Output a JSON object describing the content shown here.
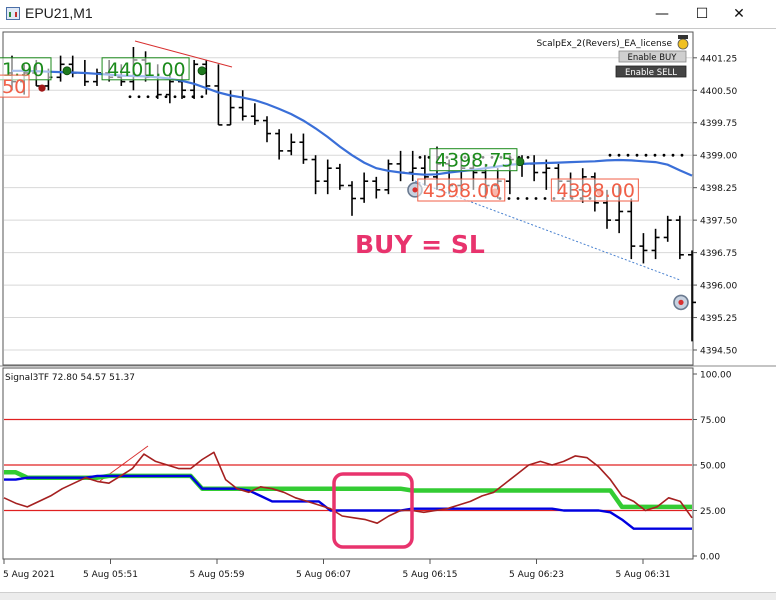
{
  "window": {
    "title": "EPU21,M1",
    "minimize_glyph": "—",
    "maximize_glyph": "☐",
    "close_glyph": "✕"
  },
  "ea_panel": {
    "name": "ScalpEx_2(Revers)_EA_license",
    "enable_buy": "Enable BUY",
    "enable_sell": "Enable SELL",
    "icon": "smiley-hat-icon"
  },
  "annotation": {
    "text": "BUY = SL",
    "color": "#e8336d"
  },
  "indicator": {
    "label": "Signal3TF 72.80 54.57 51.37"
  },
  "colors": {
    "blue_ma": "#3a6fd8",
    "dark_red": "#a52020",
    "green": "#33cc33",
    "blue_signal": "#0000e0",
    "level_line": "#e02020",
    "buy_label": "#1a8a1a",
    "sell_label": "#f06048",
    "highlight_box": "#e8336d"
  },
  "chart_data": [
    {
      "type": "candlestick-bar",
      "title": "",
      "y_ticks": [
        "4401.25",
        "4400.50",
        "4399.75",
        "4399.00",
        "4398.25",
        "4397.50",
        "4396.75",
        "4396.00",
        "4395.25",
        "4394.50"
      ],
      "ylim": [
        4394.2,
        4401.8
      ],
      "bars": [
        {
          "o": 4400.9,
          "h": 4401.3,
          "l": 4400.5,
          "c": 4400.7
        },
        {
          "o": 4400.7,
          "h": 4401.1,
          "l": 4400.4,
          "c": 4400.9
        },
        {
          "o": 4400.9,
          "h": 4401.2,
          "l": 4400.6,
          "c": 4400.6
        },
        {
          "o": 4400.6,
          "h": 4401.0,
          "l": 4400.5,
          "c": 4400.8
        },
        {
          "o": 4400.8,
          "h": 4401.3,
          "l": 4400.7,
          "c": 4401.1
        },
        {
          "o": 4401.1,
          "h": 4401.3,
          "l": 4400.8,
          "c": 4400.9
        },
        {
          "o": 4400.9,
          "h": 4401.2,
          "l": 4400.6,
          "c": 4400.7
        },
        {
          "o": 4400.7,
          "h": 4401.0,
          "l": 4400.6,
          "c": 4400.9
        },
        {
          "o": 4400.9,
          "h": 4401.2,
          "l": 4400.7,
          "c": 4400.8
        },
        {
          "o": 4400.8,
          "h": 4401.1,
          "l": 4400.6,
          "c": 4400.7
        },
        {
          "o": 4400.7,
          "h": 4401.5,
          "l": 4400.5,
          "c": 4401.2
        },
        {
          "o": 4401.2,
          "h": 4401.4,
          "l": 4400.7,
          "c": 4400.8
        },
        {
          "o": 4400.8,
          "h": 4401.1,
          "l": 4400.3,
          "c": 4400.4
        },
        {
          "o": 4400.4,
          "h": 4400.9,
          "l": 4400.2,
          "c": 4400.7
        },
        {
          "o": 4400.7,
          "h": 4400.9,
          "l": 4400.3,
          "c": 4400.5
        },
        {
          "o": 4400.5,
          "h": 4401.2,
          "l": 4400.3,
          "c": 4401.1
        },
        {
          "o": 4401.1,
          "h": 4401.2,
          "l": 4400.4,
          "c": 4400.6
        },
        {
          "o": 4400.6,
          "h": 4401.1,
          "l": 4399.7,
          "c": 4399.7
        },
        {
          "o": 4399.7,
          "h": 4400.5,
          "l": 4399.7,
          "c": 4400.1
        },
        {
          "o": 4400.1,
          "h": 4400.5,
          "l": 4399.8,
          "c": 4399.9
        },
        {
          "o": 4399.9,
          "h": 4400.2,
          "l": 4399.7,
          "c": 4399.8
        },
        {
          "o": 4399.8,
          "h": 4399.9,
          "l": 4399.3,
          "c": 4399.5
        },
        {
          "o": 4399.5,
          "h": 4399.6,
          "l": 4398.9,
          "c": 4399.1
        },
        {
          "o": 4399.1,
          "h": 4399.5,
          "l": 4399.0,
          "c": 4399.3
        },
        {
          "o": 4399.3,
          "h": 4399.5,
          "l": 4398.8,
          "c": 4398.9
        },
        {
          "o": 4398.9,
          "h": 4399.0,
          "l": 4398.1,
          "c": 4398.4
        },
        {
          "o": 4398.4,
          "h": 4398.9,
          "l": 4398.1,
          "c": 4398.7
        },
        {
          "o": 4398.7,
          "h": 4398.8,
          "l": 4398.2,
          "c": 4398.3
        },
        {
          "o": 4398.3,
          "h": 4398.4,
          "l": 4397.6,
          "c": 4398.0
        },
        {
          "o": 4398.0,
          "h": 4398.6,
          "l": 4397.9,
          "c": 4398.4
        },
        {
          "o": 4398.4,
          "h": 4398.5,
          "l": 4398.0,
          "c": 4398.2
        },
        {
          "o": 4398.2,
          "h": 4398.9,
          "l": 4398.1,
          "c": 4398.8
        },
        {
          "o": 4398.8,
          "h": 4399.1,
          "l": 4398.4,
          "c": 4398.6
        },
        {
          "o": 4398.6,
          "h": 4399.1,
          "l": 4398.4,
          "c": 4398.7
        },
        {
          "o": 4398.7,
          "h": 4399.0,
          "l": 4398.3,
          "c": 4398.5
        },
        {
          "o": 4398.5,
          "h": 4399.2,
          "l": 4398.2,
          "c": 4398.8
        },
        {
          "o": 4398.8,
          "h": 4398.9,
          "l": 4398.1,
          "c": 4398.3
        },
        {
          "o": 4398.3,
          "h": 4398.9,
          "l": 4398.1,
          "c": 4398.7
        },
        {
          "o": 4398.7,
          "h": 4398.9,
          "l": 4398.2,
          "c": 4398.6
        },
        {
          "o": 4398.6,
          "h": 4398.8,
          "l": 4398.0,
          "c": 4398.3
        },
        {
          "o": 4398.3,
          "h": 4398.7,
          "l": 4398.0,
          "c": 4398.4
        },
        {
          "o": 4398.4,
          "h": 4399.0,
          "l": 4398.1,
          "c": 4398.9
        },
        {
          "o": 4398.9,
          "h": 4399.0,
          "l": 4398.5,
          "c": 4398.8
        },
        {
          "o": 4398.8,
          "h": 4399.0,
          "l": 4398.4,
          "c": 4398.6
        },
        {
          "o": 4398.6,
          "h": 4398.9,
          "l": 4398.2,
          "c": 4398.7
        },
        {
          "o": 4398.7,
          "h": 4398.8,
          "l": 4398.1,
          "c": 4398.4
        },
        {
          "o": 4398.4,
          "h": 4398.6,
          "l": 4398.0,
          "c": 4398.2
        },
        {
          "o": 4398.2,
          "h": 4398.7,
          "l": 4397.9,
          "c": 4398.5
        },
        {
          "o": 4398.5,
          "h": 4398.6,
          "l": 4397.7,
          "c": 4397.9
        },
        {
          "o": 4397.9,
          "h": 4398.2,
          "l": 4397.3,
          "c": 4397.5
        },
        {
          "o": 4397.5,
          "h": 4398.3,
          "l": 4397.2,
          "c": 4397.7
        },
        {
          "o": 4397.7,
          "h": 4398.0,
          "l": 4396.6,
          "c": 4396.9
        },
        {
          "o": 4396.9,
          "h": 4397.2,
          "l": 4396.5,
          "c": 4396.8
        },
        {
          "o": 4396.8,
          "h": 4397.3,
          "l": 4396.6,
          "c": 4397.1
        },
        {
          "o": 4397.1,
          "h": 4397.6,
          "l": 4397.0,
          "c": 4397.5
        },
        {
          "o": 4397.5,
          "h": 4397.6,
          "l": 4396.6,
          "c": 4396.7
        },
        {
          "o": 4396.7,
          "h": 4396.8,
          "l": 4394.7,
          "c": 4395.6
        }
      ],
      "ma_values": [
        4400.95,
        4400.95,
        4400.94,
        4400.93,
        4400.92,
        4400.91,
        4400.9,
        4400.88,
        4400.86,
        4400.84,
        4400.83,
        4400.82,
        4400.8,
        4400.77,
        4400.72,
        4400.65,
        4400.55,
        4400.45,
        4400.38,
        4400.33,
        4400.27,
        4400.18,
        4400.07,
        4399.95,
        4399.8,
        4399.62,
        4399.42,
        4399.2,
        4399.0,
        4398.83,
        4398.7,
        4398.64,
        4398.6,
        4398.57,
        4398.55,
        4398.56,
        4398.6,
        4398.63,
        4398.66,
        4398.7,
        4398.74,
        4398.78,
        4398.8,
        4398.81,
        4398.82,
        4398.83,
        4398.84,
        4398.85,
        4398.86,
        4398.88,
        4398.89,
        4398.88,
        4398.86,
        4398.84,
        4398.78,
        4398.65,
        4398.53
      ],
      "labels": [
        {
          "text": "1.90",
          "price": 4400.95,
          "bar": 0,
          "color": "#1a8a1a"
        },
        {
          "text": "4401.00",
          "price": 4400.95,
          "bar": 11,
          "color": "#1a8a1a"
        },
        {
          "text": "4398.75",
          "price": 4398.85,
          "bar": 38,
          "color": "#1a8a1a"
        },
        {
          "text": "50",
          "price": 4400.55,
          "bar": 0,
          "color": "#f06048"
        },
        {
          "text": "4398.00",
          "price": 4398.15,
          "bar": 37,
          "color": "#f06048"
        },
        {
          "text": "4398.00",
          "price": 4398.15,
          "bar": 48,
          "color": "#f06048"
        }
      ]
    },
    {
      "type": "line",
      "title": "",
      "y_ticks": [
        "100.00",
        "75.00",
        "50.00",
        "25.00",
        "0.00"
      ],
      "ylim": [
        0,
        100
      ],
      "levels": [
        75,
        50,
        25
      ],
      "x_ticks": [
        "5 Aug 2021",
        "5 Aug 05:51",
        "5 Aug 05:59",
        "5 Aug 06:07",
        "5 Aug 06:15",
        "5 Aug 06:23",
        "5 Aug 06:31"
      ],
      "series": [
        {
          "color": "#a52020",
          "values": [
            32,
            29,
            27,
            30,
            33,
            37,
            40,
            43,
            41,
            40,
            44,
            48,
            56,
            52,
            50,
            48,
            48,
            53,
            57,
            42,
            37,
            35,
            38,
            37,
            35,
            32,
            30,
            28,
            26,
            22,
            21,
            20,
            18,
            22,
            25,
            25,
            24,
            25,
            26,
            28,
            30,
            33,
            35,
            40,
            45,
            50,
            52,
            50,
            52,
            55,
            54,
            49,
            42,
            33,
            30,
            25,
            27,
            32,
            30,
            21
          ]
        },
        {
          "color": "#33cc33",
          "values": [
            46,
            46,
            43,
            43,
            43,
            43,
            43,
            43,
            43,
            44,
            44,
            44,
            44,
            44,
            44,
            44,
            44,
            37,
            37,
            37,
            37,
            37,
            37,
            37,
            37,
            37,
            37,
            37,
            37,
            37,
            37,
            37,
            37,
            37,
            37,
            36,
            36,
            36,
            36,
            36,
            36,
            36,
            36,
            36,
            36,
            36,
            36,
            36,
            36,
            36,
            36,
            36,
            36,
            27,
            27,
            27,
            27,
            27,
            27,
            27
          ]
        },
        {
          "color": "#0000e0",
          "values": [
            42,
            42,
            43,
            43,
            43,
            43,
            43,
            43,
            44,
            44,
            44,
            44,
            44,
            44,
            44,
            44,
            44,
            37,
            37,
            37,
            37,
            36,
            33,
            30,
            30,
            30,
            30,
            30,
            25,
            25,
            25,
            25,
            25,
            25,
            25,
            26,
            26,
            26,
            26,
            26,
            26,
            26,
            26,
            26,
            26,
            26,
            26,
            26,
            25,
            25,
            25,
            25,
            24,
            20,
            15,
            15,
            15,
            15,
            15,
            15
          ]
        }
      ]
    }
  ]
}
